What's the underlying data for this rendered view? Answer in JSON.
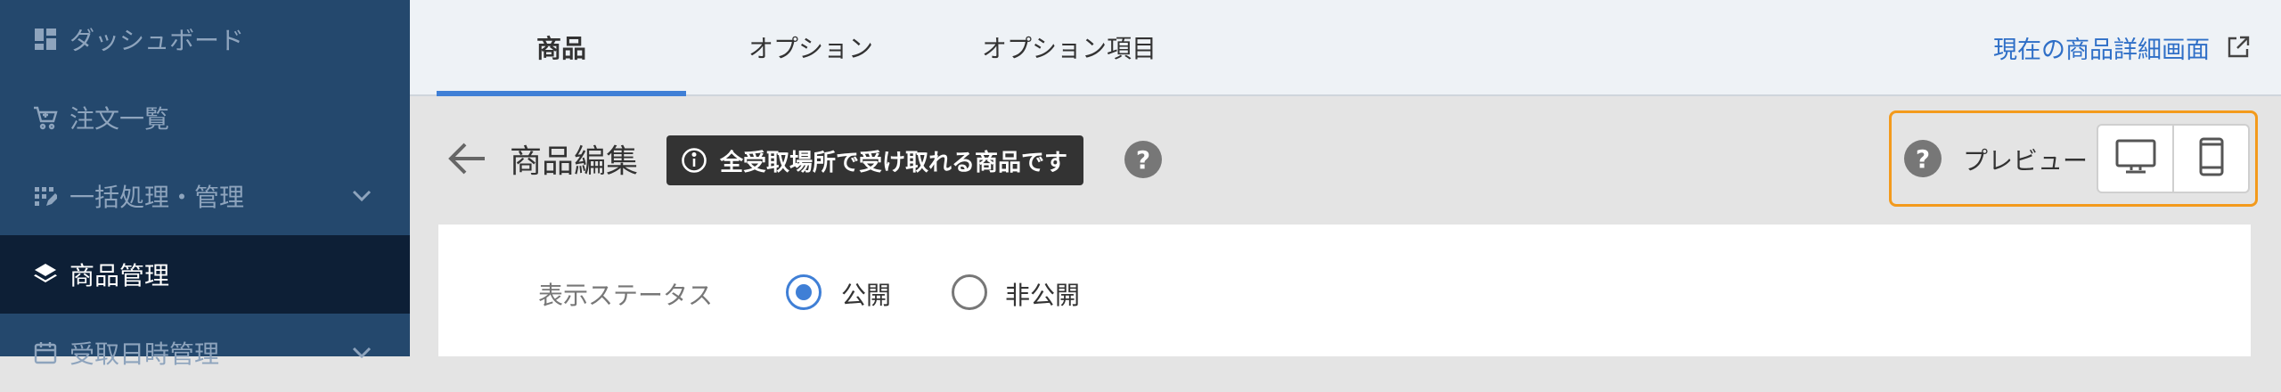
{
  "sidebar": {
    "items": [
      {
        "label": "ダッシュボード",
        "icon": "dashboard-icon"
      },
      {
        "label": "注文一覧",
        "icon": "cart-icon"
      },
      {
        "label": "一括処理・管理",
        "icon": "batch-icon",
        "expandable": true
      },
      {
        "label": "商品管理",
        "icon": "layers-icon",
        "active": true
      },
      {
        "label": "受取日時管理",
        "icon": "calendar-icon",
        "expandable": true
      }
    ]
  },
  "tabs": [
    {
      "label": "商品",
      "active": true
    },
    {
      "label": "オプション"
    },
    {
      "label": "オプション項目"
    }
  ],
  "detail_link": "現在の商品詳細画面",
  "header": {
    "title": "商品編集",
    "badge": "全受取場所で受け取れる商品です",
    "help": "?",
    "preview_label": "プレビュー"
  },
  "form": {
    "status_label": "表示ステータス",
    "options": [
      {
        "label": "公開",
        "checked": true
      },
      {
        "label": "非公開",
        "checked": false
      }
    ]
  },
  "colors": {
    "sidebar_bg": "#24486d",
    "sidebar_active": "#0d1f36",
    "accent": "#3f7fd6",
    "highlight_border": "#f39a1c"
  }
}
